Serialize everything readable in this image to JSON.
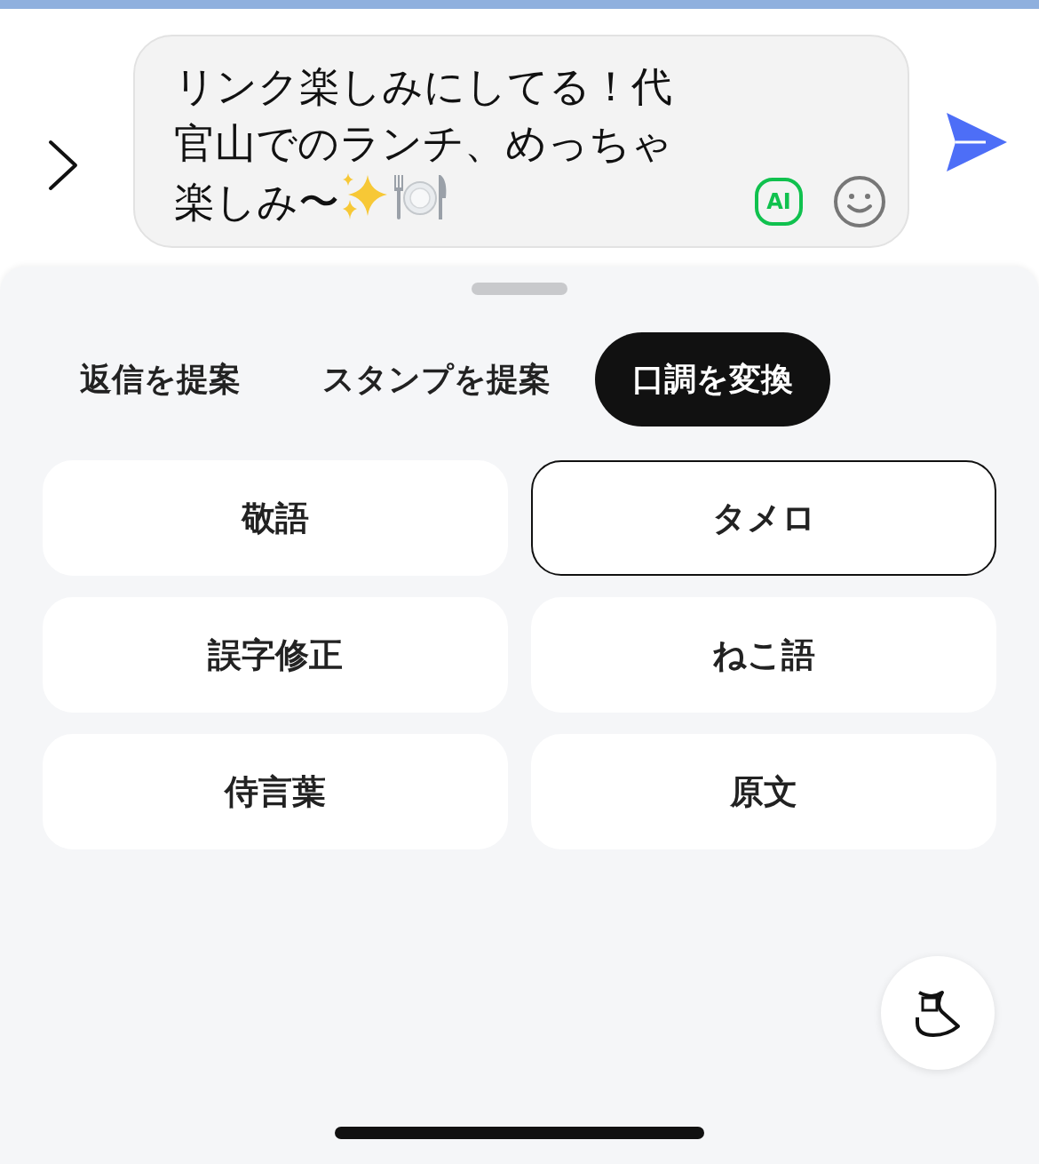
{
  "composer": {
    "message_lines": [
      "リンク楽しみにしてる！代",
      "官山でのランチ、めっちゃ",
      "楽しみ〜"
    ],
    "ai_badge": "AI"
  },
  "tabs": [
    {
      "label": "返信を提案",
      "selected": false
    },
    {
      "label": "スタンプを提案",
      "selected": false
    },
    {
      "label": "口調を変換",
      "selected": true
    }
  ],
  "options": [
    {
      "label": "敬語",
      "selected": false
    },
    {
      "label": "タメロ",
      "selected": true
    },
    {
      "label": "誤字修正",
      "selected": false
    },
    {
      "label": "ねこ語",
      "selected": false
    },
    {
      "label": "侍言葉",
      "selected": false
    },
    {
      "label": "原文",
      "selected": false
    }
  ]
}
